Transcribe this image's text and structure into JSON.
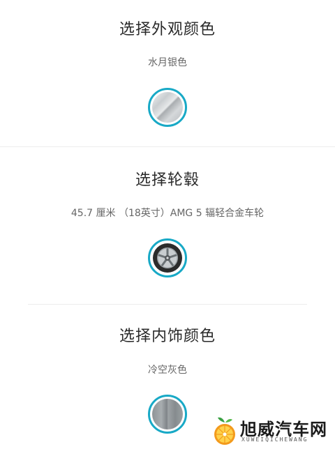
{
  "sections": [
    {
      "title": "选择外观颜色",
      "option": "水月银色",
      "swatch_icon": "silver-paint-swatch"
    },
    {
      "title": "选择轮毂",
      "option": "45.7 厘米 （18英寸）AMG 5 辐轻合金车轮",
      "swatch_icon": "wheel-icon"
    },
    {
      "title": "选择内饰颜色",
      "option": "冷空灰色",
      "swatch_icon": "grey-interior-swatch"
    }
  ],
  "watermark": {
    "name": "旭威汽车网",
    "sub": "XUWEIQICHEWANG"
  },
  "colors": {
    "accent": "#18a9c6",
    "divider": "#ececec",
    "title": "#2a2a2a",
    "subtitle": "#666666"
  }
}
